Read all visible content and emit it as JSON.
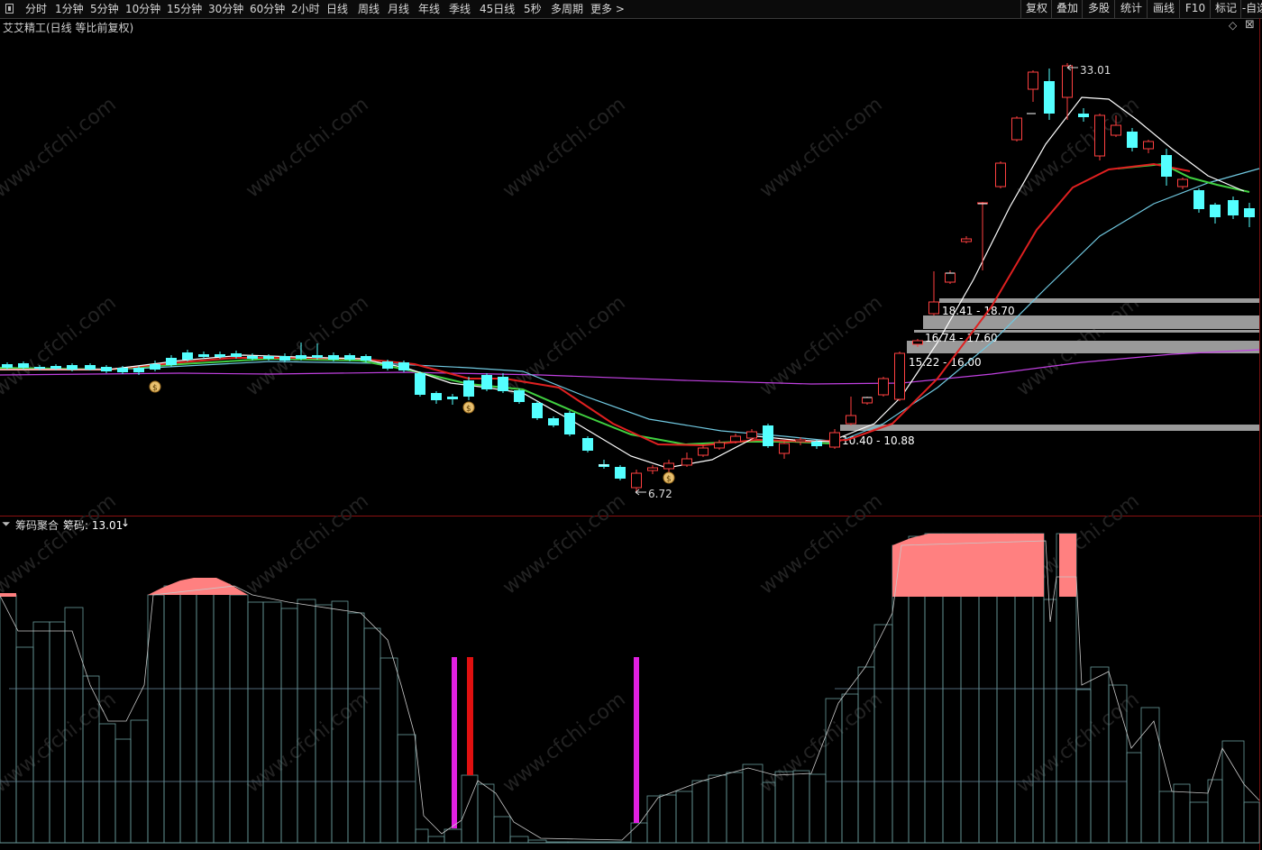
{
  "toolbar": {
    "periods": [
      "分时",
      "1分钟",
      "5分钟",
      "10分钟",
      "15分钟",
      "30分钟",
      "60分钟",
      "2小时",
      "日线",
      "周线",
      "月线",
      "年线",
      "季线",
      "45日线",
      "5秒",
      "多周期",
      "更多 >"
    ],
    "right_buttons": [
      "复权",
      "叠加",
      "多股",
      "统计",
      "画线",
      "F10",
      "标记",
      "-自选"
    ]
  },
  "main_chart": {
    "title": "艾艾精工(日线 等比前复权)",
    "high_label": "33.01",
    "low_label": "6.72",
    "zones": [
      "18.41 - 18.70",
      "16.74 - 17.60",
      "15.22 - 16.00",
      "10.40 - 10.88"
    ]
  },
  "indicator": {
    "name": "筹码聚合",
    "value_label": "筹码: 13.01",
    "arrow": "↓"
  },
  "watermark": "www.cfchi.com",
  "colors": {
    "up": "#ff4040",
    "down": "#54ffff",
    "ma_white": "#ffffff",
    "ma_red": "#e02020",
    "ma_green": "#40d040",
    "ma_cyan": "#70c8e0",
    "ma_purple": "#c040e0",
    "zone": "#9a9a9a",
    "pink": "#ff8080",
    "magenta": "#e020e0"
  }
}
